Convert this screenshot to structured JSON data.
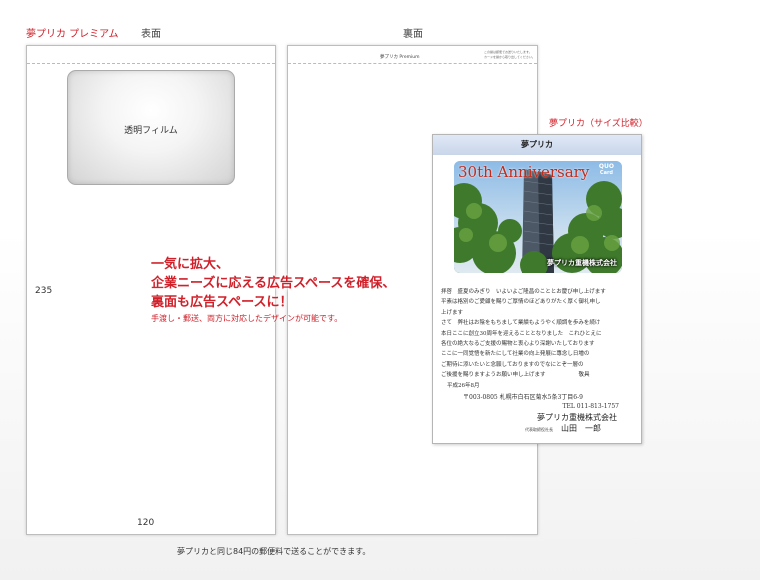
{
  "labels": {
    "premium": "夢プリカ プレミアム",
    "front": "表面",
    "back": "裏面",
    "size_compare": "夢プリカ（サイズ比較）"
  },
  "front_panel": {
    "window_label": "透明フィルム",
    "height_label": "235",
    "width_label": "120"
  },
  "back_panel": {
    "header_title": "夢プリカ Premium",
    "header_note_1": "この袋は郵便でお送りいたします。",
    "header_note_2": "カードを袋から取り出してください。"
  },
  "promo": {
    "line1": "一気に拡大、",
    "line2": "企業ニーズに応える広告スペースを確保、",
    "line3": "裏面も広告スペースに！",
    "sub": "手渡し・郵送、両方に対応したデザインが可能です。"
  },
  "card": {
    "title": "夢プリカ",
    "banner": "30th Anniversary",
    "brand": "QUO",
    "brand_sub": "Card",
    "company_on_card": "夢プリカ重機株式会社",
    "letter_lines": [
      "拝啓　盛夏のみぎり　いよいよご隆昌のこととお慶び申し上げます",
      "平素は格別のご愛顧を賜りご厚情のほどありがたく厚く御礼申し",
      "上げます",
      "さて　弊社はお陰をもちまして業績もようやく順調を歩みを続け",
      "本日ここに創立30周年を迎えることとなりました　これひとえに",
      "各位の絶大なるご支援の賜物と衷心より深謝いたしております",
      "ここに一同覚悟を新たにして社業の向上発展に專念し日増の",
      "ご期待に添いたいと念願しておりますのでなにとぞ一層の",
      "ご後援を賜りますようお願い申し上げます　　　　　　敬具",
      "平成26年8月"
    ],
    "address_line": "〒003-0805 札幌市白石区菊水5条3丁目6-9",
    "tel_line": "TEL 011-813-1757",
    "company_name": "夢プリカ重機株式会社",
    "rep_title": "代表取締役社長",
    "rep_name": "山田　一郎"
  },
  "footer": {
    "note": "夢プリカと同じ84円の郵便料で送ることができます。"
  },
  "colors": {
    "accent": "#d0202a",
    "banner": "#c42a1a"
  }
}
